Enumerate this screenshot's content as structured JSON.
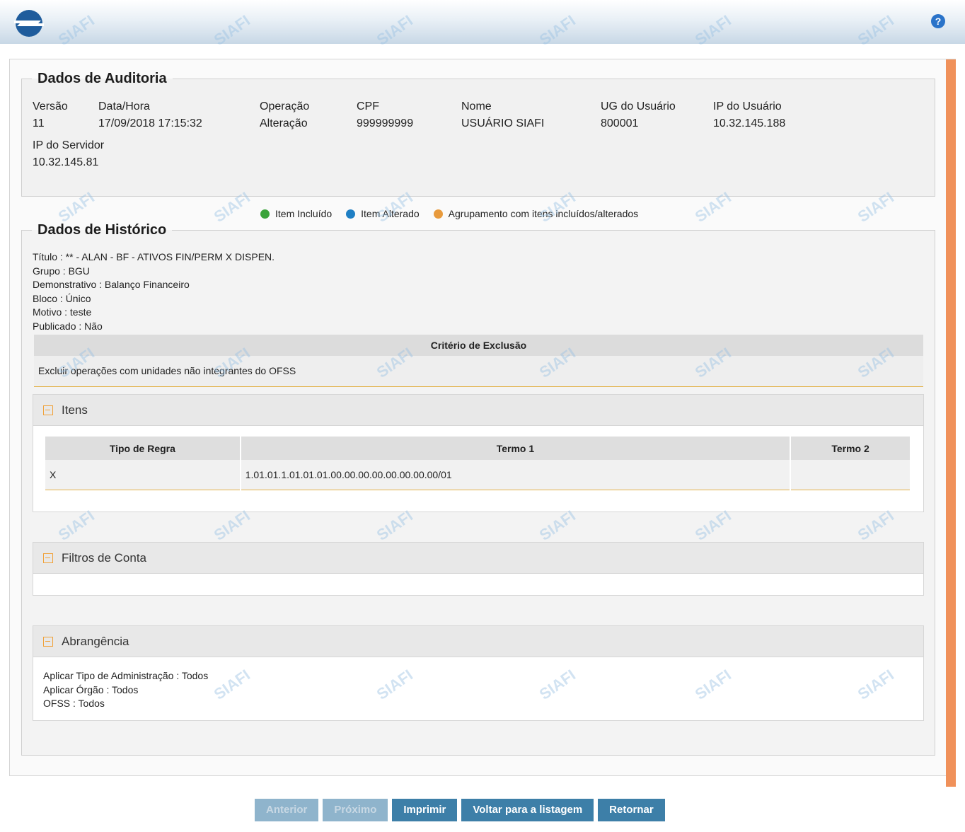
{
  "header": {
    "logo_icon": "siafi-logo-icon",
    "help_icon": "help-icon",
    "help_glyph": "?"
  },
  "auditoria": {
    "title": "Dados de Auditoria",
    "fields": [
      {
        "label": "Versão",
        "value": "11"
      },
      {
        "label": "Data/Hora",
        "value": "17/09/2018 17:15:32"
      },
      {
        "label": "Operação",
        "value": "Alteração"
      },
      {
        "label": "CPF",
        "value": "999999999"
      },
      {
        "label": "Nome",
        "value": "USUÁRIO SIAFI"
      },
      {
        "label": "UG do Usuário",
        "value": "800001"
      },
      {
        "label": "IP do Usuário",
        "value": "10.32.145.188"
      },
      {
        "label": "IP do Servidor",
        "value": "10.32.145.81"
      }
    ]
  },
  "legend": {
    "items": [
      {
        "label": "Item Incluído",
        "color": "#3aa33a"
      },
      {
        "label": "Item Alterado",
        "color": "#1f7fc4"
      },
      {
        "label": "Agrupamento com itens incluídos/alterados",
        "color": "#e89a3c"
      }
    ]
  },
  "historico": {
    "title": "Dados de Histórico",
    "meta": [
      "Título : ** - ALAN - BF - ATIVOS FIN/PERM X DISPEN.",
      "Grupo : BGU",
      "Demonstrativo : Balanço Financeiro",
      "Bloco : Único",
      "Motivo : teste",
      "Publicado : Não"
    ],
    "criterio": {
      "header": "Critério de Exclusão",
      "value": "Excluir operações com unidades não integrantes do OFSS"
    },
    "itens": {
      "title": "Itens",
      "columns": [
        "Tipo de Regra",
        "Termo 1",
        "Termo 2"
      ],
      "rows": [
        [
          "X",
          "1.01.01.1.01.01.01.00.00.00.00.00.00.00.00/01",
          ""
        ]
      ]
    },
    "filtros": {
      "title": "Filtros de Conta"
    },
    "abrangencia": {
      "title": "Abrangência",
      "lines": [
        "Aplicar Tipo de Administração : Todos",
        "Aplicar Órgão : Todos",
        "OFSS : Todos"
      ]
    }
  },
  "buttons": {
    "anterior": "Anterior",
    "proximo": "Próximo",
    "imprimir": "Imprimir",
    "voltar": "Voltar para a listagem",
    "retornar": "Retornar"
  },
  "watermark": "SIAFI"
}
